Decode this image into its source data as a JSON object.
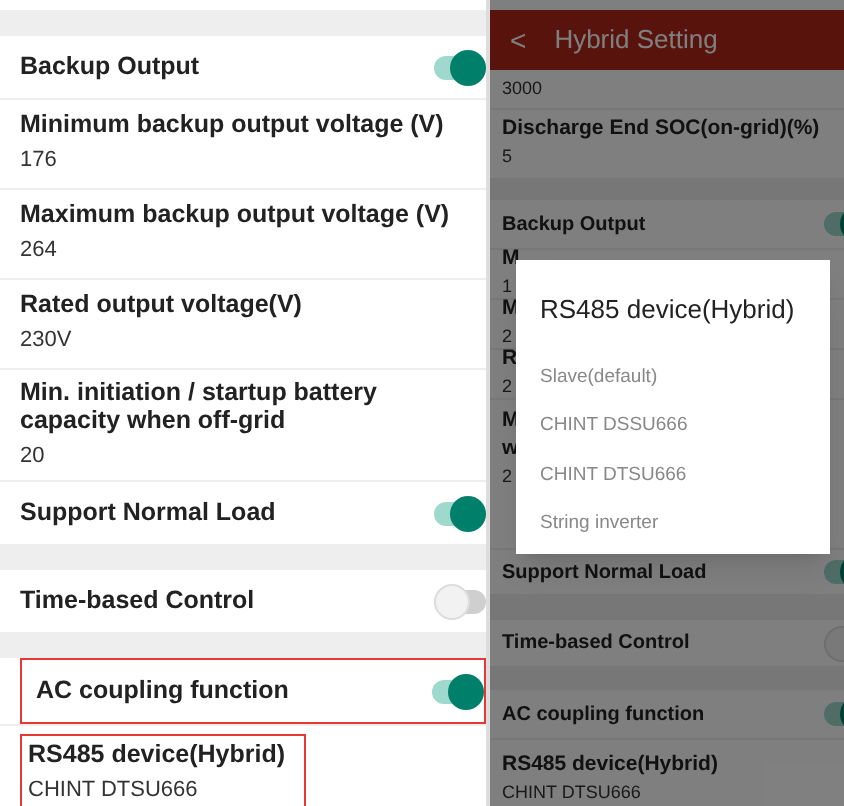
{
  "left_screen": {
    "rows": [
      {
        "kind": "gap"
      },
      {
        "kind": "toggle",
        "label": "Backup Output",
        "on": true,
        "highlighted": false
      },
      {
        "kind": "value",
        "label": "Minimum backup output voltage (V)",
        "value": "176",
        "highlighted": false
      },
      {
        "kind": "value",
        "label": "Maximum backup output voltage (V)",
        "value": "264",
        "highlighted": false
      },
      {
        "kind": "value",
        "label": "Rated output voltage(V)",
        "value": "230V",
        "highlighted": false
      },
      {
        "kind": "value",
        "label": "Min. initiation / startup battery capacity when off-grid",
        "value": "20",
        "highlighted": false
      },
      {
        "kind": "toggle",
        "label": "Support Normal Load",
        "on": true,
        "highlighted": false
      },
      {
        "kind": "gap"
      },
      {
        "kind": "toggle",
        "label": "Time-based Control",
        "on": false,
        "highlighted": false
      },
      {
        "kind": "gap"
      },
      {
        "kind": "toggle",
        "label": "AC coupling function",
        "on": true,
        "highlighted": true
      },
      {
        "kind": "value",
        "label": "RS485 device(Hybrid)",
        "value": "CHINT DTSU666",
        "highlighted": true
      }
    ]
  },
  "right_screen": {
    "header": {
      "back": "<",
      "title": "Hybrid Setting"
    },
    "rows": [
      {
        "kind": "value",
        "value": "3000"
      },
      {
        "kind": "value",
        "label": "Discharge End SOC(on-grid)(%)",
        "value": "5"
      },
      {
        "kind": "gap"
      },
      {
        "kind": "toggle",
        "label": "Backup Output",
        "on": true
      },
      {
        "kind": "value",
        "label": "M",
        "value": "1"
      },
      {
        "kind": "value",
        "label": "M",
        "value": "2"
      },
      {
        "kind": "value",
        "label": "R",
        "value": "2"
      },
      {
        "kind": "value",
        "label": "M",
        "label_2": "w",
        "value": "2"
      },
      {
        "kind": "toggle",
        "label": "Support Normal Load",
        "on": true
      },
      {
        "kind": "gap"
      },
      {
        "kind": "toggle",
        "label": "Time-based Control",
        "on": false
      },
      {
        "kind": "gap"
      },
      {
        "kind": "toggle",
        "label": "AC coupling function",
        "on": true
      },
      {
        "kind": "value",
        "label": "RS485 device(Hybrid)",
        "value": "CHINT DTSU666"
      }
    ],
    "dialog": {
      "title": "RS485 device(Hybrid)",
      "options": [
        "Slave(default)",
        "CHINT DSSU666",
        "CHINT DTSU666",
        "String inverter"
      ]
    }
  }
}
